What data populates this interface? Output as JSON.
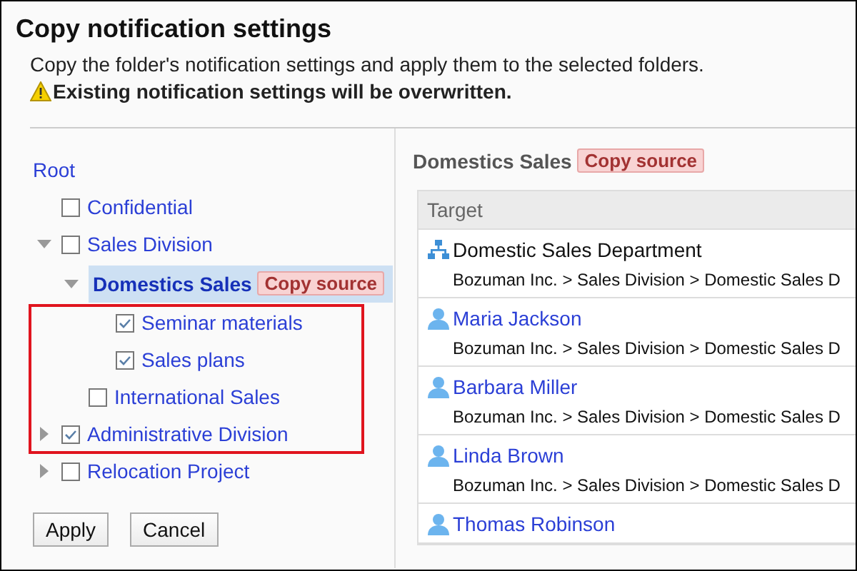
{
  "window": {
    "title": "Copy notification settings"
  },
  "description": "Copy the folder's notification settings and apply them to the selected folders.",
  "warning": "Existing notification settings will be overwritten.",
  "tree": {
    "highlight_frame": true,
    "items": [
      {
        "kind": "root",
        "label": "Root",
        "children": [
          {
            "kind": "folder",
            "label": "Confidential",
            "checked": false
          },
          {
            "kind": "folder",
            "label": "Sales Division",
            "checked": false,
            "expanded": true,
            "children": [
              {
                "kind": "source",
                "label": "Domestics Sales",
                "badge": "Copy source",
                "expanded": true,
                "children": [
                  {
                    "kind": "folder",
                    "label": "Seminar materials",
                    "checked": true
                  },
                  {
                    "kind": "folder",
                    "label": "Sales plans",
                    "checked": true
                  }
                ]
              },
              {
                "kind": "folder",
                "label": "International Sales",
                "checked": false
              }
            ]
          },
          {
            "kind": "folder",
            "label": "Administrative Division",
            "checked": true,
            "expanded": false
          },
          {
            "kind": "folder",
            "label": "Relocation Project",
            "checked": false,
            "expanded": false
          }
        ]
      }
    ]
  },
  "buttons": [
    "Apply",
    "Cancel"
  ],
  "detail": {
    "title": "Domestics Sales",
    "badge": "Copy source",
    "table": {
      "columns": [
        "Target"
      ],
      "rows": [
        {
          "kind": "department",
          "name": "Domestic Sales Department",
          "path": "Bozuman Inc. > Sales Division > Domestic Sales D"
        },
        {
          "kind": "user",
          "name": "Maria Jackson",
          "path": "Bozuman Inc. > Sales Division > Domestic Sales D"
        },
        {
          "kind": "user",
          "name": "Barbara Miller",
          "path": "Bozuman Inc. > Sales Division > Domestic Sales D"
        },
        {
          "kind": "user",
          "name": "Linda Brown",
          "path": "Bozuman Inc. > Sales Division > Domestic Sales D"
        },
        {
          "kind": "user",
          "name": "Thomas Robinson"
        }
      ]
    }
  }
}
